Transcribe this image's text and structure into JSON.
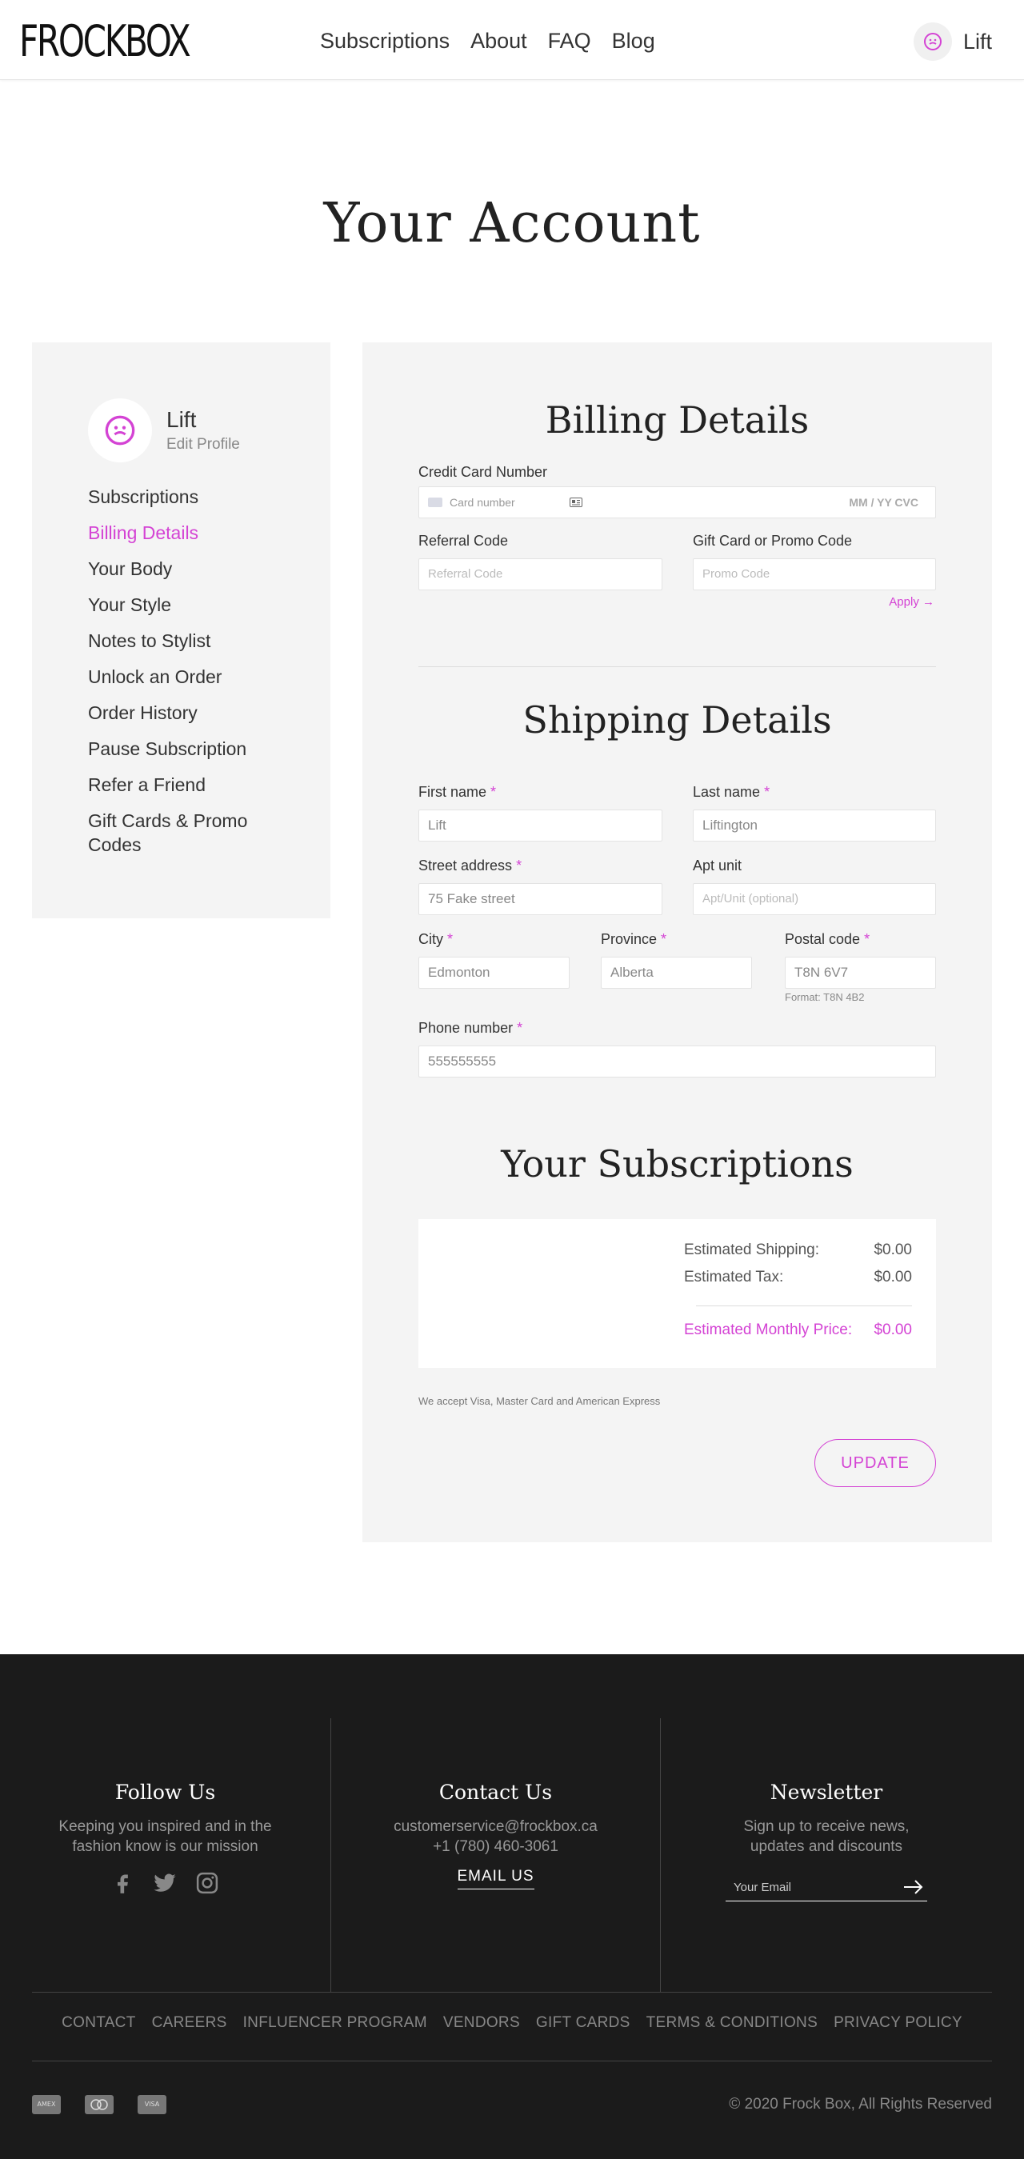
{
  "header": {
    "logo": "FROCKBOX",
    "nav": [
      "Subscriptions",
      "About",
      "FAQ",
      "Blog"
    ],
    "user_name": "Lift"
  },
  "page_title": "Your Account",
  "sidebar": {
    "name": "Lift",
    "edit_profile": "Edit Profile",
    "items": [
      "Subscriptions",
      "Billing Details",
      "Your Body",
      "Your Style",
      "Notes to Stylist",
      "Unlock an Order",
      "Order History",
      "Pause Subscription",
      "Refer a Friend",
      "Gift Cards & Promo Codes"
    ],
    "active_item": "Billing Details"
  },
  "billing": {
    "title": "Billing Details",
    "credit_card_label": "Credit Card Number",
    "card_number_placeholder": "Card number",
    "expiry_cvc_placeholder": "MM / YY  CVC",
    "referral_label": "Referral Code",
    "referral_placeholder": "Referral Code",
    "promo_label": "Gift Card or Promo Code",
    "promo_placeholder": "Promo Code",
    "apply": "Apply →"
  },
  "shipping": {
    "title": "Shipping Details",
    "first_name_label": "First name",
    "first_name": "Lift",
    "last_name_label": "Last name",
    "last_name": "Liftington",
    "street_label": "Street address",
    "street": "75 Fake street",
    "apt_label": "Apt unit",
    "apt_placeholder": "Apt/Unit (optional)",
    "city_label": "City",
    "city": "Edmonton",
    "province_label": "Province",
    "province": "Alberta",
    "postal_label": "Postal code",
    "postal": "T8N 6V7",
    "postal_hint": "Format: T8N 4B2",
    "phone_label": "Phone number",
    "phone": "555555555",
    "required_mark": "*"
  },
  "subscriptions": {
    "title": "Your Subscriptions",
    "shipping_label": "Estimated Shipping:",
    "shipping_value": "$0.00",
    "tax_label": "Estimated Tax:",
    "tax_value": "$0.00",
    "monthly_label": "Estimated Monthly Price:",
    "monthly_value": "$0.00",
    "accept_note": "We accept Visa, Master Card and American Express",
    "update_button": "UPDATE"
  },
  "footer": {
    "follow_title": "Follow Us",
    "follow_text": "Keeping you inspired and in the fashion know is our mission",
    "contact_title": "Contact Us",
    "contact_email": "customerservice@frockbox.ca",
    "contact_phone": "+1 (780) 460-3061",
    "email_us": "EMAIL US",
    "newsletter_title": "Newsletter",
    "newsletter_text": "Sign up to receive news, updates and discounts",
    "newsletter_placeholder": "Your Email",
    "links": [
      "CONTACT",
      "CAREERS",
      "INFLUENCER PROGRAM",
      "VENDORS",
      "GIFT CARDS",
      "TERMS & CONDITIONS",
      "PRIVACY POLICY"
    ],
    "payment_cards": [
      "AMEX",
      "MC",
      "VISA"
    ],
    "copyright": "© 2020 Frock Box, All Rights Reserved"
  },
  "colors": {
    "accent": "#d443d4",
    "panel_bg": "#f4f4f4",
    "footer_bg": "#1b1b1b"
  }
}
